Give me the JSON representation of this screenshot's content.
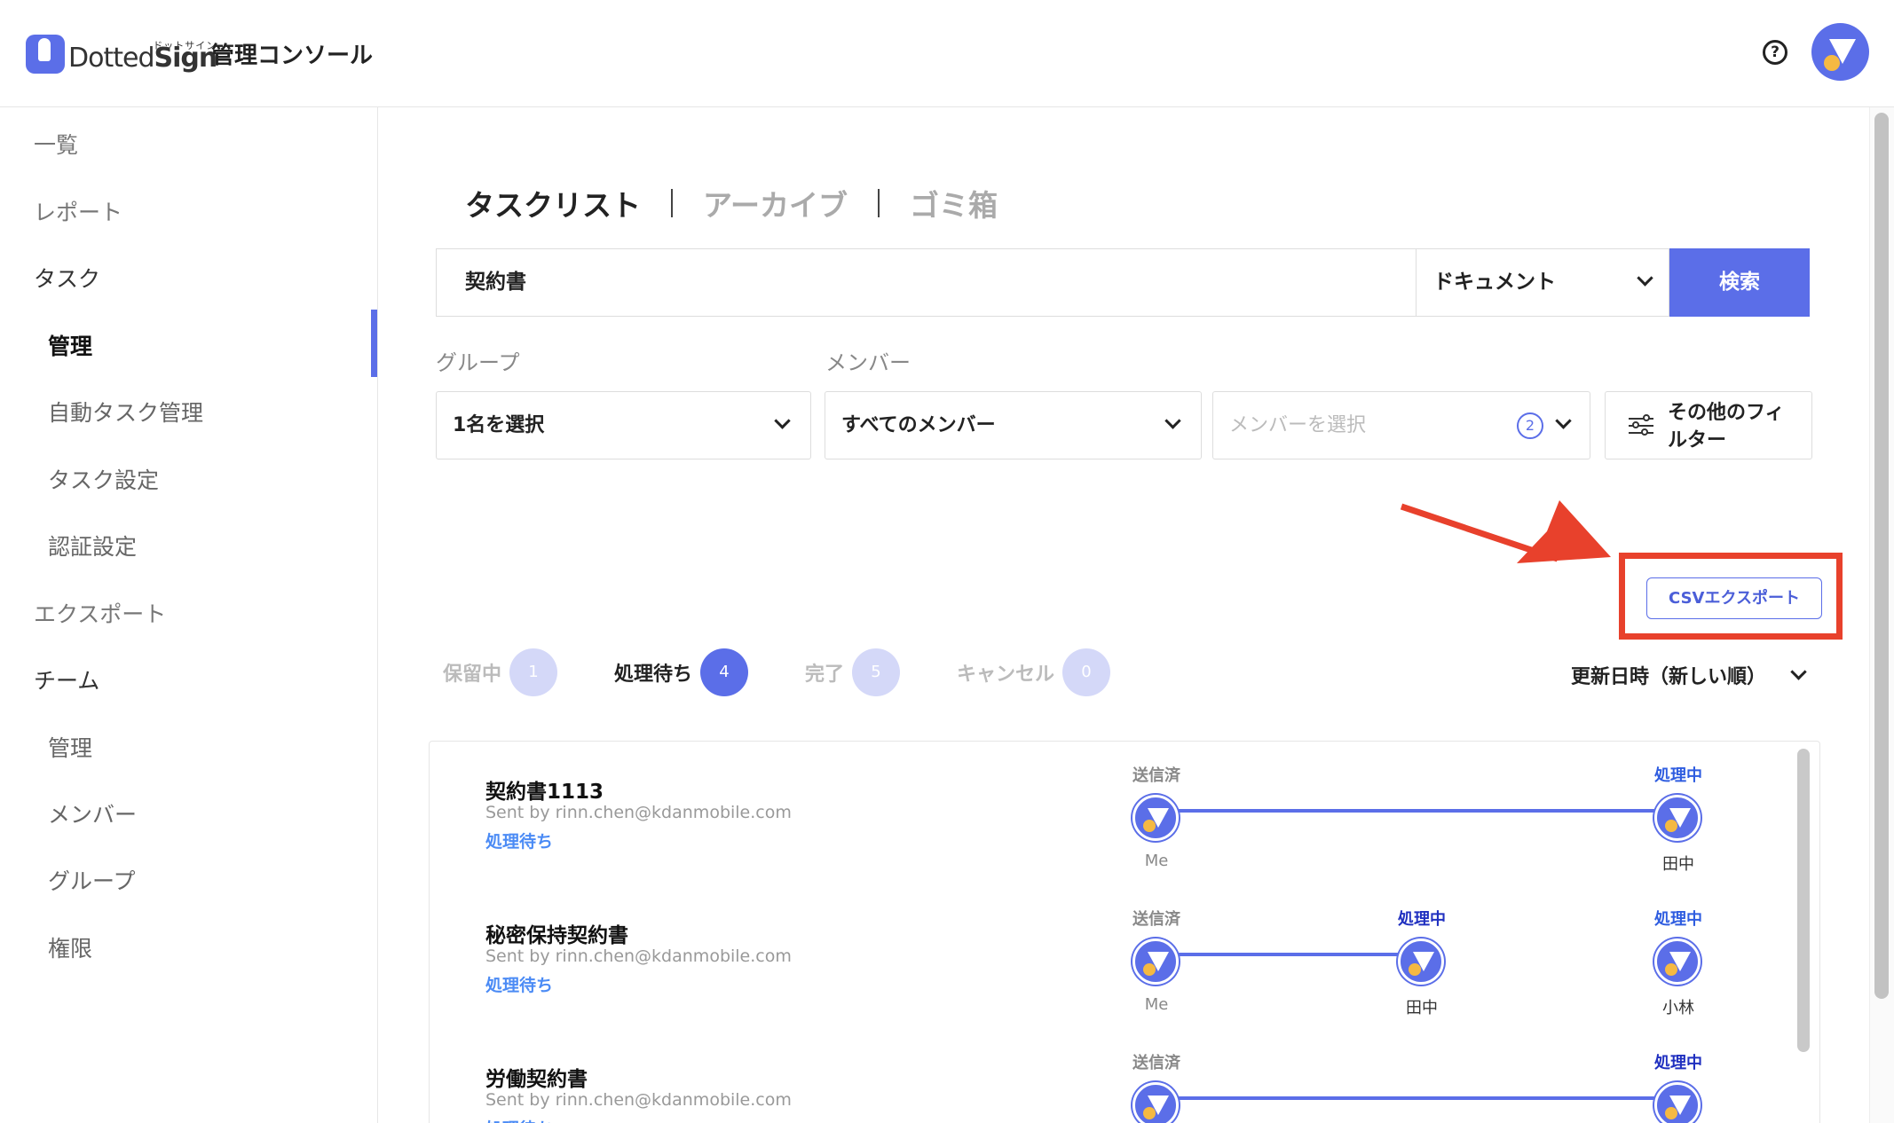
{
  "header": {
    "logo_text_light": "Dotted",
    "logo_text_bold": "Sign",
    "logo_kana": "ドットサイン",
    "title": "管理コンソール"
  },
  "sidebar": {
    "items": [
      {
        "label": "一覧"
      },
      {
        "label": "レポート"
      },
      {
        "label": "タスク"
      },
      {
        "label": "管理"
      },
      {
        "label": "自動タスク管理"
      },
      {
        "label": "タスク設定"
      },
      {
        "label": "認証設定"
      },
      {
        "label": "エクスポート"
      },
      {
        "label": "チーム"
      },
      {
        "label": "管理"
      },
      {
        "label": "メンバー"
      },
      {
        "label": "グループ"
      },
      {
        "label": "権限"
      }
    ]
  },
  "main": {
    "tabs": [
      {
        "label": "タスクリスト"
      },
      {
        "label": "アーカイブ"
      },
      {
        "label": "ゴミ箱"
      }
    ],
    "search": {
      "value": "契約書",
      "type_select": "ドキュメント",
      "button": "検索"
    },
    "filters": {
      "group_label": "グループ",
      "member_label": "メンバー",
      "group_select": "1名を選択",
      "member_select": "すべてのメンバー",
      "member_pick_placeholder": "メンバーを選択",
      "member_pick_count": "2",
      "other_filters": "その他のフィルター"
    },
    "csv_export": "CSVエクスポート",
    "status_tabs": [
      {
        "label": "保留中",
        "count": "1"
      },
      {
        "label": "処理待ち",
        "count": "4"
      },
      {
        "label": "完了",
        "count": "5"
      },
      {
        "label": "キャンセル",
        "count": "0"
      }
    ],
    "sort": "更新日時（新しい順）",
    "tasks": [
      {
        "name": "契約書1113",
        "sender": "Sent by rinn.chen@kdanmobile.com",
        "status": "処理待ち",
        "steps": [
          {
            "top": "送信済",
            "bottom": "Me"
          },
          {
            "top": "処理中",
            "bottom": "田中"
          }
        ]
      },
      {
        "name": "秘密保持契約書",
        "sender": "Sent by rinn.chen@kdanmobile.com",
        "status": "処理待ち",
        "steps": [
          {
            "top": "送信済",
            "bottom": "Me"
          },
          {
            "top": "処理中",
            "bottom": "田中"
          },
          {
            "top": "処理中",
            "bottom": "小林"
          }
        ]
      },
      {
        "name": "労働契約書",
        "sender": "Sent by rinn.chen@kdanmobile.com",
        "status": "処理待ち",
        "steps": [
          {
            "top": "送信済",
            "bottom": ""
          },
          {
            "top": "処理中",
            "bottom": ""
          }
        ]
      }
    ]
  },
  "colors": {
    "accent": "#5b6ee8",
    "highlight": "#e8412c",
    "status_link": "#4b8bf5"
  },
  "icons": {
    "help": "help-circle-icon",
    "filter": "sliders-icon",
    "chevron": "chevron-down-icon"
  }
}
